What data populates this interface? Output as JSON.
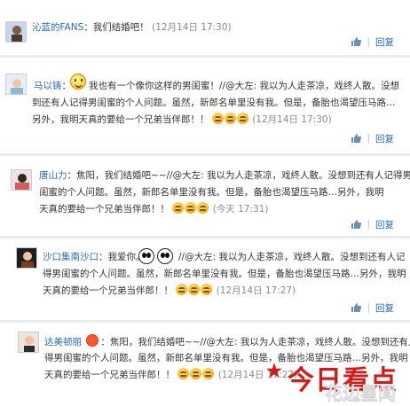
{
  "comments": [
    {
      "user": "沁蓝的FANS",
      "text": "：我们结婚吧！",
      "time": "(12月14日 17:30)",
      "reply_label": "回复"
    },
    {
      "user": "马以铸",
      "text_l1a": "：",
      "text_l1b": "我也有一个像你这样的男闺蜜！//@大左: 我以为人走茶凉，戏终人散。没想",
      "text_l2": "到还有人记得男闺蜜的个人问题。虽然，新郎名单里没有我。但是，备胎也渴望压马路",
      "text_l3": "另外，我明天真的要给一个兄弟当伴郎！！",
      "time": "(12月14日 17:30)",
      "reply_label": "回复"
    },
    {
      "user": "唐山力",
      "text_l1": "：焦阳，我们结婚吧~~//@大左: 我以为人走茶凉，戏终人散。没想到还有人记得男",
      "text_l2": "闺蜜的个人问题。虽然，新郎名单里没有我。但是，备胎也渴望压马路…另外，我明",
      "text_l3a": "天真的要给一个兄弟当伴郎！！",
      "time": "(今天 17:31)",
      "reply_label": "回复"
    },
    {
      "user": "沙口集南沙口",
      "text_l1a": "：我爱你。",
      "text_l1b": "//@大左: 我以为人走茶凉，戏终人散。没想到还有人记",
      "text_l2": "得男闺蜜的个人问题。虽然，新郎名单里没有我。但是，备胎也渴望压马路…另外，我明",
      "text_l3": "天真的要给一个兄弟当伴郎！！",
      "time": "(12月14日 17:27)",
      "reply_label": "回复"
    },
    {
      "user": "达美顿丽",
      "text_l1": "：焦阳，我们结婚吧~~//@大左: 我以为人走茶凉，戏终人散。没想到还有人记",
      "text_l2": "得男闺蜜的个人问题。虽然，新郎名单里没有我。但是，备胎也渴望压马路…另外，我明",
      "text_l3": "天真的要给一个兄弟当伴郎！！",
      "time": "(12月14日 17:27)"
    }
  ],
  "logo": {
    "main": "今日看点",
    "sub": "花边星闻"
  },
  "icons": [
    "like-icon",
    "avatar",
    "emoji-icon",
    "panda-emoji-icon",
    "smile-emoji-icon"
  ],
  "colors": {
    "link": "#2a6ab6",
    "muted": "#8a8a8a",
    "separator": "#e9ecf1",
    "logo_red": "#d31b1b"
  }
}
